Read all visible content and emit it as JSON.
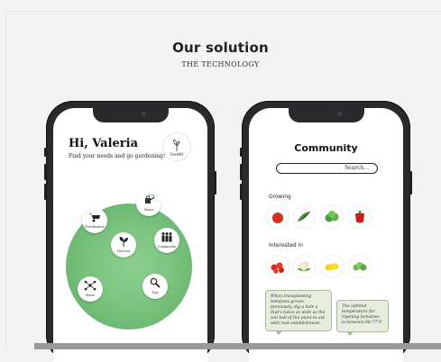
{
  "slide": {
    "title": "Our solution",
    "subtitle": "THE TECHNOLOGY"
  },
  "left_screen": {
    "greeting": "Hi, Valeria",
    "greeting_sub": "Find your needs and go gardening!",
    "logo_text": "GreeNY",
    "nodes": [
      {
        "label": "Fertilization",
        "icon": "wheelbarrow-icon"
      },
      {
        "label": "Water",
        "icon": "watering-can-icon"
      },
      {
        "label": "Harvest",
        "icon": "sprout-icon"
      },
      {
        "label": "Community",
        "icon": "people-icon"
      },
      {
        "label": "Share",
        "icon": "share-network-icon"
      },
      {
        "label": "Tips",
        "icon": "magnifier-icon"
      }
    ]
  },
  "right_screen": {
    "title": "Community",
    "search_placeholder": "Search...",
    "growing_label": "Growing",
    "interested_label": "Interested in",
    "growing": [
      "tomato-icon",
      "cucumber-icon",
      "lettuce-icon",
      "pepper-icon"
    ],
    "interested": [
      "cherry-tomatoes-icon",
      "cauliflower-icon",
      "lemon-icon",
      "greens-icon"
    ],
    "note_left": "When transplanting tomatoes grown previously, dig a hole a that's twice as wide as the soil ball of the plant to aid with root establishment.",
    "note_right": "The optimal temperature for ripening tomatoes is between 68-77°F"
  },
  "colors": {
    "accent_green": "#7ec582",
    "phone_frame": "#2a2a2c",
    "note_bg": "#e6eddd"
  }
}
